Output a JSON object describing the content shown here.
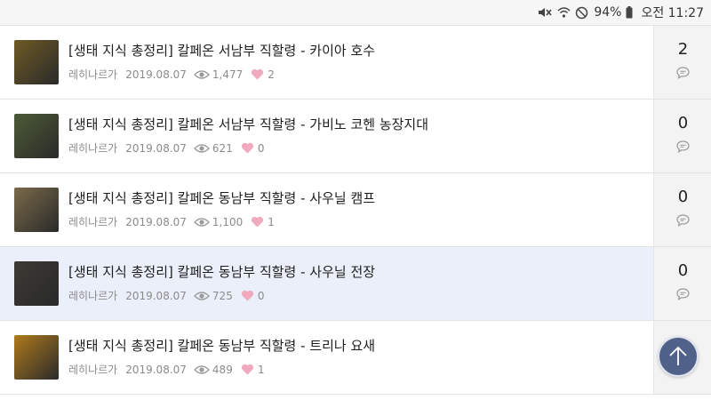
{
  "status_bar": {
    "battery": "94%",
    "time": "오전 11:27",
    "icons": [
      "mute-icon",
      "wifi-icon",
      "do-not-disturb-icon",
      "battery-icon"
    ]
  },
  "posts": [
    {
      "title": "[생태 지식 총정리] 칼페온 서남부 직할령 - 카이아 호수",
      "author": "레히나르가",
      "date": "2019.08.07",
      "views": "1,477",
      "likes": "2",
      "comments": "2",
      "thumb_color": "#6e5a24"
    },
    {
      "title": "[생태 지식 총정리] 칼페온 서남부 직할령 - 가비노 코헨 농장지대",
      "author": "레히나르가",
      "date": "2019.08.07",
      "views": "621",
      "likes": "0",
      "comments": "0",
      "thumb_color": "#4c5a36"
    },
    {
      "title": "[생태 지식 총정리] 칼페온 동남부 직할령 - 사우닐 캠프",
      "author": "레히나르가",
      "date": "2019.08.07",
      "views": "1,100",
      "likes": "1",
      "comments": "0",
      "thumb_color": "#7a6a4a"
    },
    {
      "title": "[생태 지식 총정리] 칼페온 동남부 직할령 - 사우닐 전장",
      "author": "레히나르가",
      "date": "2019.08.07",
      "views": "725",
      "likes": "0",
      "comments": "0",
      "thumb_color": "#3c3a34"
    },
    {
      "title": "[생태 지식 총정리] 칼페온 동남부 직할령 - 트리나 요새",
      "author": "레히나르가",
      "date": "2019.08.07",
      "views": "489",
      "likes": "1",
      "comments": "",
      "thumb_color": "#b07a1c"
    }
  ],
  "colors": {
    "highlight_row": "#eaeffa",
    "like_heart": "#f0a9bd",
    "scroll_button": "#50618a"
  },
  "scroll_top_icon": "arrow-up-icon"
}
